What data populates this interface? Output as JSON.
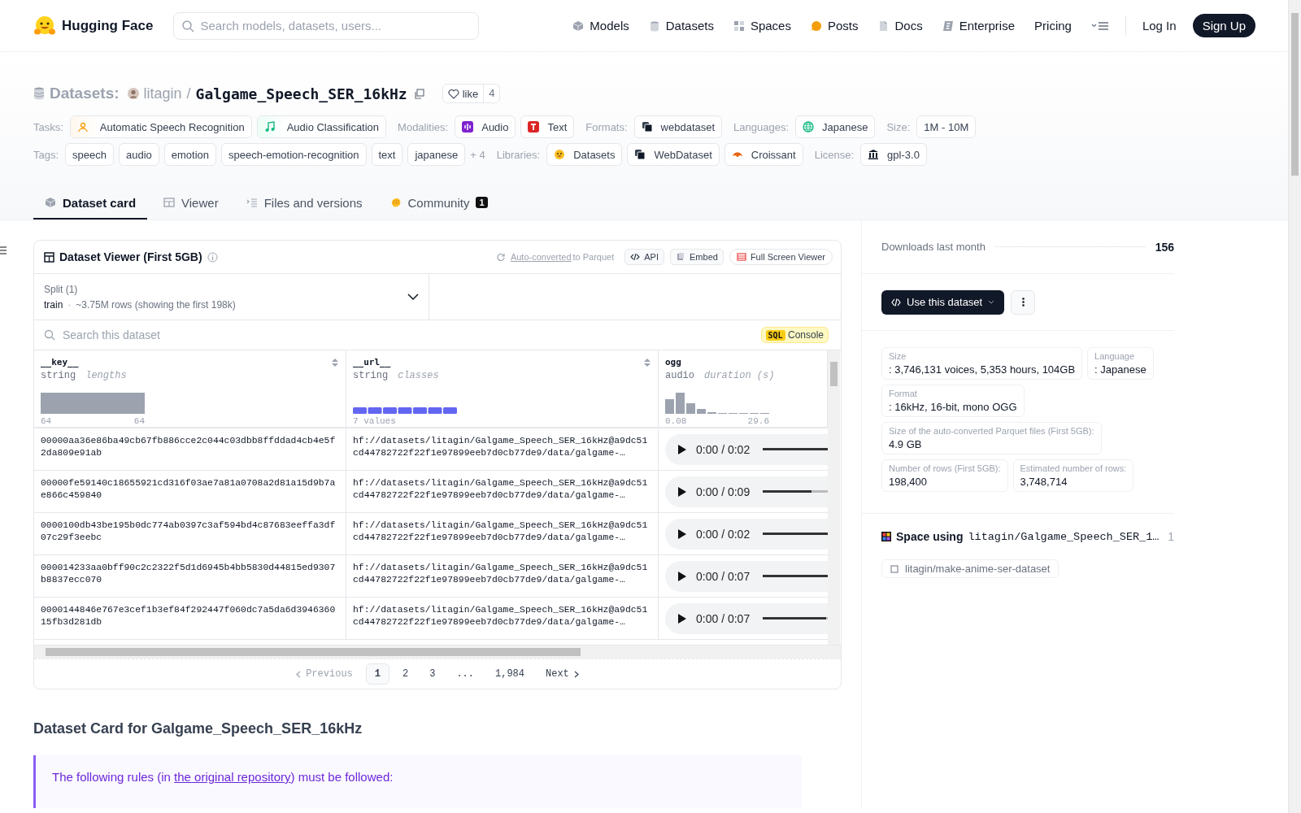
{
  "header": {
    "brand": "Hugging Face",
    "search": {
      "placeholder": "Search models, datasets, users..."
    },
    "nav": [
      {
        "label": "Models",
        "kind": "cube"
      },
      {
        "label": "Datasets",
        "kind": "stack"
      },
      {
        "label": "Spaces",
        "kind": "grid"
      },
      {
        "label": "Posts",
        "kind": "bubble"
      },
      {
        "label": "Docs",
        "kind": "doc"
      },
      {
        "label": "Enterprise",
        "kind": "enterprise"
      },
      {
        "label": "Pricing",
        "kind": "plain"
      }
    ],
    "login": "Log In",
    "signup": "Sign Up"
  },
  "repo": {
    "section": "Datasets:",
    "owner": "litagin",
    "separator": "/",
    "name": "Galgame_Speech_SER_16kHz",
    "like": "like",
    "likes": "4"
  },
  "tag_rows": [
    [
      {
        "label": "Tasks:",
        "items": [
          {
            "text": "Automatic Speech Recognition",
            "kind": "speech"
          },
          {
            "text": "Audio Classification",
            "kind": "music"
          }
        ]
      },
      {
        "label": "Modalities:",
        "items": [
          {
            "text": "Audio",
            "kind": "audio"
          },
          {
            "text": "Text",
            "kind": "text"
          }
        ]
      },
      {
        "label": "Formats:",
        "items": [
          {
            "text": "webdataset",
            "kind": "webdataset"
          }
        ]
      },
      {
        "label": "Languages:",
        "items": [
          {
            "text": "Japanese",
            "kind": "globe"
          }
        ]
      },
      {
        "label": "Size:",
        "items": [
          {
            "text": "1M - 10M",
            "kind": "plain"
          }
        ]
      }
    ],
    [
      {
        "label": "Tags:",
        "items": [
          {
            "text": "speech",
            "kind": "plain"
          },
          {
            "text": "audio",
            "kind": "plain"
          },
          {
            "text": "emotion",
            "kind": "plain"
          },
          {
            "text": "speech-emotion-recognition",
            "kind": "plain"
          },
          {
            "text": "text",
            "kind": "plain"
          },
          {
            "text": "japanese",
            "kind": "plain"
          }
        ],
        "more": "+ 4"
      },
      {
        "label": "Libraries:",
        "items": [
          {
            "text": "Datasets",
            "kind": "hf"
          },
          {
            "text": "WebDataset",
            "kind": "webdataset"
          },
          {
            "text": "Croissant",
            "kind": "croissant"
          }
        ]
      },
      {
        "label": "License:",
        "items": [
          {
            "text": "gpl-3.0",
            "kind": "license"
          }
        ]
      }
    ]
  ],
  "tabs": [
    {
      "label": "Dataset card",
      "kind": "card",
      "selected": true
    },
    {
      "label": "Viewer",
      "kind": "table",
      "selected": false
    },
    {
      "label": "Files and versions",
      "kind": "files",
      "selected": false
    },
    {
      "label": "Community",
      "kind": "community",
      "selected": false,
      "badge": "1"
    }
  ],
  "viewer": {
    "title": "Dataset Viewer (First 5GB)",
    "converted_link": "Auto-converted",
    "converted_text": "to Parquet",
    "buttons": [
      {
        "label": "API",
        "kind": "code"
      },
      {
        "label": "Embed",
        "kind": "embed"
      },
      {
        "label": "Full Screen Viewer",
        "kind": "fullscreen"
      }
    ],
    "split": {
      "label": "Split (1)",
      "value": "train",
      "separator": "·",
      "rows": "~3.75M rows (showing the first 198k)"
    },
    "search": {
      "placeholder": "Search this dataset"
    },
    "sql": {
      "tag": "SQL",
      "label": "Console"
    },
    "columns": [
      {
        "name": "__key__",
        "type": "string",
        "stat": "lengths",
        "kind": "range",
        "min": "64",
        "max": "64"
      },
      {
        "name": "__url__",
        "type": "string",
        "stat": "classes",
        "kind": "classes",
        "note": "7 values"
      },
      {
        "name": "ogg",
        "type": "audio",
        "stat": "duration (s)",
        "kind": "histogram",
        "min": "0.08",
        "max": "29.6"
      }
    ],
    "rows": [
      {
        "key": "00000aa36e86ba49cb67fb886cce2c044c03dbb8ffddad4cb4e5f2da809e91ab",
        "url": "hf://datasets/litagin/Galgame_Speech_SER_16kHz@a9dc51cd44782722f22f1e97899eeb7d0cb77de9/data/galgame-…",
        "time": "0:00 / 0:02",
        "level": 1
      },
      {
        "key": "00000fe59140c18655921cd316f03ae7a81a0708a2d81a15d9b7ae866c459840",
        "url": "hf://datasets/litagin/Galgame_Speech_SER_16kHz@a9dc51cd44782722f22f1e97899eeb7d0cb77de9/data/galgame-…",
        "time": "0:00 / 0:09",
        "level": 0.5
      },
      {
        "key": "0000100db43be195b0dc774ab0397c3af594bd4c87683eeffa3df07c29f3eebc",
        "url": "hf://datasets/litagin/Galgame_Speech_SER_16kHz@a9dc51cd44782722f22f1e97899eeb7d0cb77de9/data/galgame-…",
        "time": "0:00 / 0:02",
        "level": 1
      },
      {
        "key": "000014233aa0bff90c2c2322f5d1d6945b4bb5830d44815ed9307b8837ecc070",
        "url": "hf://datasets/litagin/Galgame_Speech_SER_16kHz@a9dc51cd44782722f22f1e97899eeb7d0cb77de9/data/galgame-…",
        "time": "0:00 / 0:07",
        "level": 0.72
      },
      {
        "key": "0000144846e767e3cef1b3ef84f292447f060dc7a5da6d394636015fb3d281db",
        "url": "hf://datasets/litagin/Galgame_Speech_SER_16kHz@a9dc51cd44782722f22f1e97899eeb7d0cb77de9/data/galgame-…",
        "time": "0:00 / 0:07",
        "level": 0.65
      }
    ],
    "pagination": {
      "previous": "Previous",
      "pages": [
        {
          "label": "1",
          "selected": true
        },
        {
          "label": "2",
          "selected": false
        },
        {
          "label": "3",
          "selected": false
        },
        {
          "label": "...",
          "selected": false
        },
        {
          "label": "1,984",
          "selected": false
        }
      ],
      "next": "Next"
    }
  },
  "card": {
    "heading": "Dataset Card for Galgame_Speech_SER_16kHz",
    "notice": {
      "before": "The following rules (in ",
      "link": "the original repository",
      "after": ") must be followed:"
    }
  },
  "sidebar": {
    "downloads_label": "Downloads last month",
    "downloads": "156",
    "use_button": "Use this dataset",
    "facts": [
      {
        "label": "Size",
        "value": ": 3,746,131 voices, 5,353 hours, 104GB"
      },
      {
        "label": "Language",
        "value": ": Japanese"
      },
      {
        "label": "Format",
        "value": ": 16kHz, 16-bit, mono OGG"
      },
      {
        "label": "Size of the auto-converted Parquet files (First 5GB):",
        "value": "4.9 GB"
      },
      {
        "label": "Number of rows (First 5GB):",
        "value": "198,400"
      },
      {
        "label": "Estimated number of rows:",
        "value": "3,748,714"
      }
    ],
    "spaces": {
      "title": "Space using",
      "repo": "litagin/Galgame_Speech_SER_1…",
      "count": "1",
      "items": [
        "litagin/make-anime-ser-dataset"
      ]
    }
  }
}
